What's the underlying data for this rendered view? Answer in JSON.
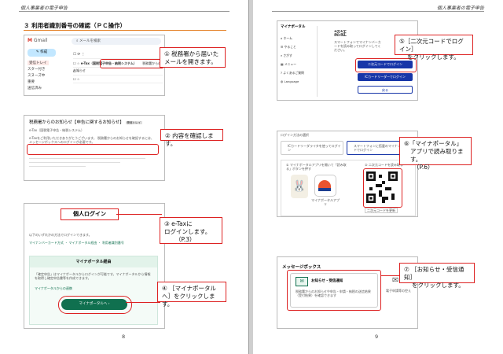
{
  "left_page": {
    "header": "個人事業者の電子申告",
    "section_title": "３ 利用者識別番号の確認（ＰＣ操作）",
    "page_number": "8",
    "gmail": {
      "app_name": "Gmail",
      "search_placeholder": "メールを検索",
      "compose": "作成",
      "sidebar": [
        "受信トレイ",
        "スター付き",
        "スヌーズ中",
        "重要",
        "送信済み"
      ],
      "rows": [
        {
          "sender": "e-Tax（国税電子申告・納税システム）",
          "subject": "税務署からのお知らせ"
        },
        {
          "sender": "",
          "subject": ""
        },
        {
          "sender": "",
          "subject": ""
        }
      ]
    },
    "notice": {
      "title": "税務署からのお知らせ【申告に関するお知らせ】",
      "tag": "受信トレイ",
      "sender": "e-Tax（国税電子申告・納税システム）",
      "body": "e-Taxをご利用いただきありがとうございます。 税務署からのお知らせを確認するには、メッセージボックスへのログインが必要です。"
    },
    "login": {
      "title": "個人ログイン",
      "intro": "以下のいずれかの方法でログインできます。",
      "links": [
        "マイナンバーカード方式",
        "マイナポータル経由",
        "利用者識別番号"
      ],
      "panel_title": "マイナポータル経由",
      "panel_text": "「確定申告」はマイナポータルからログインが可能です。マイナポータルから情報を取得し確定申告書等を作成できます。",
      "panel_link": "マイナポータルからの連携",
      "button": "マイナポータルへ"
    },
    "callouts": {
      "c1": "① 税務署から届いたメールを開きます。",
      "c2": "② 内容を確認します。",
      "c3_line1": "③ e-Taxに",
      "c3_line2": "ログインします。",
      "c3_line3": "（P.3）",
      "c4": "④ ［マイナポータルへ］をクリックします。"
    }
  },
  "right_page": {
    "header": "個人事業者の電子申告",
    "page_number": "9",
    "portal": {
      "brand": "マイナポータル",
      "heading": "認証",
      "menu": [
        "ホーム",
        "やること",
        "さがす",
        "メニュー",
        "よくあるご質問",
        "Language"
      ],
      "desc": "スマートフォンでマイナンバーカードを読み取ってログインしてください。",
      "btn_qr": "二次元コードでログイン",
      "btn_reader": "ICカードリーダーでログイン",
      "btn_back": "戻る"
    },
    "qr_screen": {
      "header": "ログイン方法の選択",
      "option1": "ICカードリーダライタを使ってログイン",
      "option2": "スマートフォンに搭載のマイナンバーカードでログイン",
      "step1": "① マイナポータルアプリを開いて「読み取る」ボタンを押す",
      "step2": "② 二次元コードを読み取る",
      "app_label": "マイナポータルアプリ",
      "qr_caption": "二次元コードを更新"
    },
    "message_box": {
      "title": "メッセージボックス",
      "card_title": "お知らせ・受信通知",
      "card_text": "税務署からのお知らせや申告・申請・納税の送信結果（受付結果）を確認できます",
      "side_label": "電子申請等の控え"
    },
    "callouts": {
      "c5_line1": "⑤［二次元コードでログイン］",
      "c5_line2": "をクリックします。",
      "c6_line1": "⑥「マイナポータル」",
      "c6_line2": "アプリで読み取ります。",
      "c6_line3": "（P.6）",
      "c7_line1": "⑦ ［お知らせ・受信通知］",
      "c7_line2": "をクリックします。"
    }
  },
  "colors": {
    "accent_red": "#d22222",
    "rule_orange": "#e37b1c",
    "portal_blue": "#1736a8",
    "etax_green": "#10704f"
  }
}
